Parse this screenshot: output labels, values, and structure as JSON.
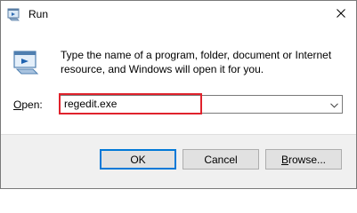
{
  "window": {
    "title": "Run",
    "title_icon": "run-icon",
    "close_icon": "close-icon"
  },
  "prompt": {
    "icon": "run-icon",
    "description": "Type the name of a program, folder, document or Internet resource, and Windows will open it for you."
  },
  "open_field": {
    "label_accel": "O",
    "label_rest": "pen:",
    "value": "regedit.exe",
    "dropdown_icon": "chevron-down-icon",
    "highlight_color": "#e0222c"
  },
  "buttons": {
    "ok": "OK",
    "cancel": "Cancel",
    "browse_accel": "B",
    "browse_rest": "rowse..."
  },
  "colors": {
    "accent": "#0078d7",
    "footer": "#f0f0f0"
  }
}
